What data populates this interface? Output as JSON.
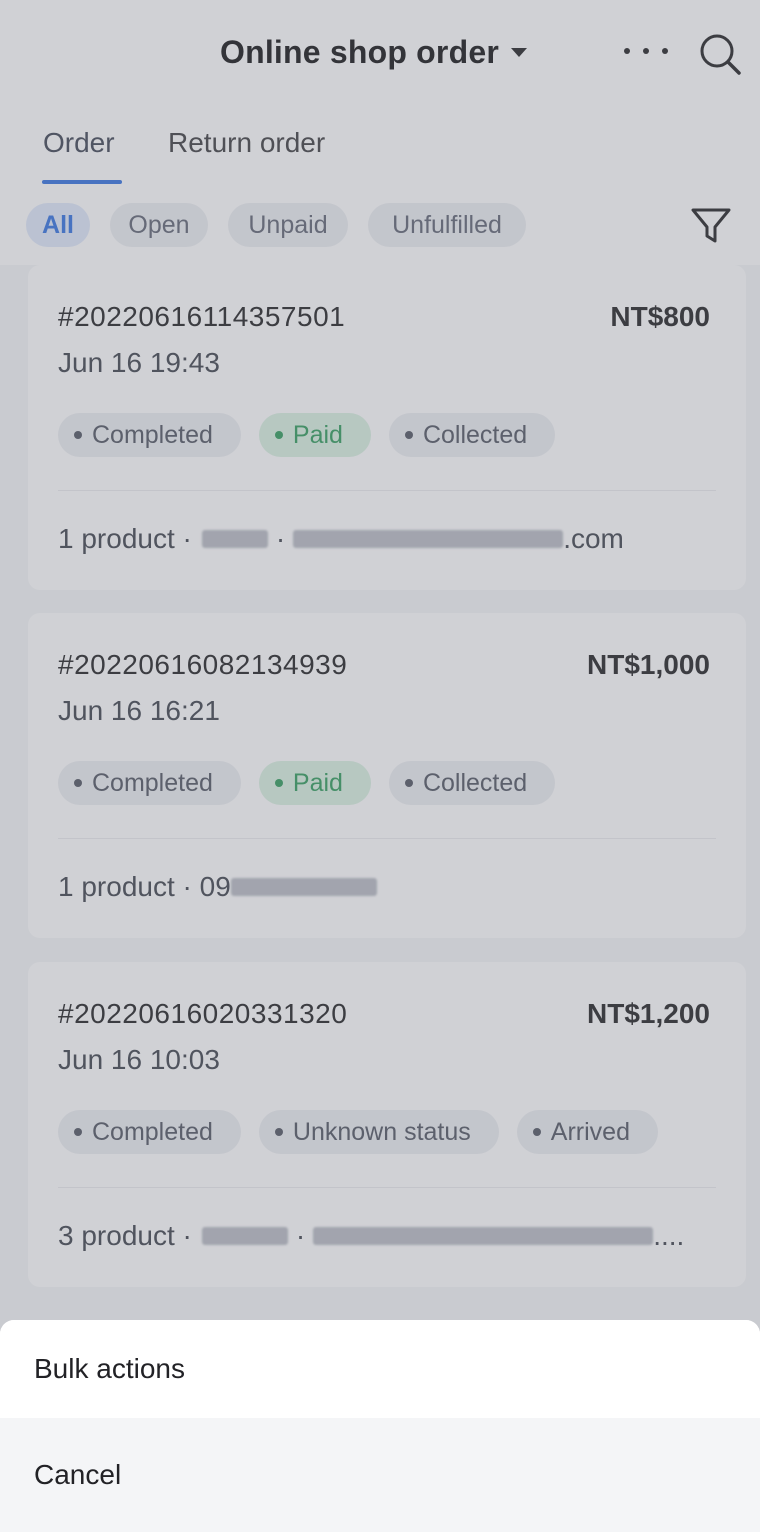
{
  "header": {
    "title": "Online shop order",
    "more_icon": "more-dots-icon",
    "search_icon": "search-icon"
  },
  "tabs": [
    {
      "label": "Order",
      "selected": true
    },
    {
      "label": "Return order",
      "selected": false
    }
  ],
  "filters": [
    {
      "label": "All",
      "selected": true
    },
    {
      "label": "Open",
      "selected": false
    },
    {
      "label": "Unpaid",
      "selected": false
    },
    {
      "label": "Unfulfilled",
      "selected": false
    }
  ],
  "filter_icon": "filter-funnel-icon",
  "orders": [
    {
      "id": "#20220616114357501",
      "amount": "NT$800",
      "date": "Jun 16 19:43",
      "badges": [
        "Completed",
        "Paid",
        "Collected"
      ],
      "summary_prefix": "1 product ·",
      "summary_suffix": ".com"
    },
    {
      "id": "#20220616082134939",
      "amount": "NT$1,000",
      "date": "Jun 16 16:21",
      "badges": [
        "Completed",
        "Paid",
        "Collected"
      ],
      "summary_prefix": "1 product · 09",
      "summary_suffix": ""
    },
    {
      "id": "#20220616020331320",
      "amount": "NT$1,200",
      "date": "Jun 16 10:03",
      "badges": [
        "Completed",
        "Unknown status",
        "Arrived"
      ],
      "summary_prefix": "3 product ·",
      "summary_suffix": "...."
    }
  ],
  "sheet": {
    "bulk_actions": "Bulk actions",
    "cancel": "Cancel"
  },
  "colors": {
    "accent": "#2e6fe0",
    "paid_green": "#2b9a58",
    "overlay": "rgba(120,124,134,0.35)"
  }
}
